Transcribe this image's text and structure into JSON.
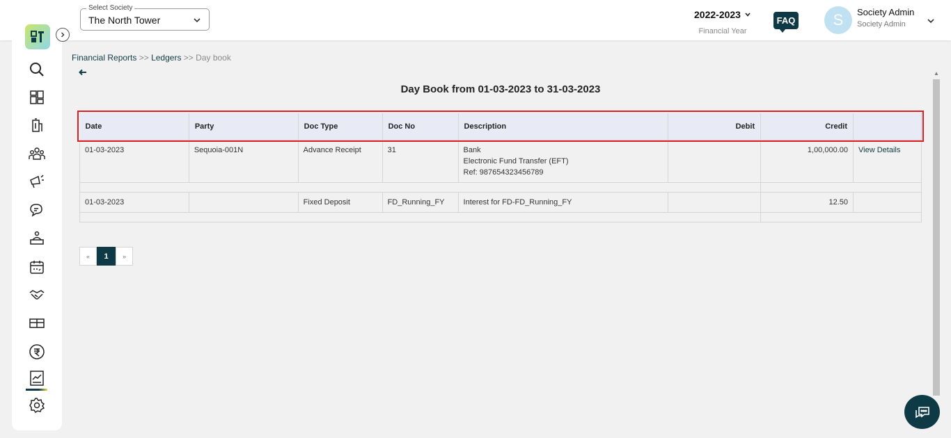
{
  "society_select": {
    "legend": "Select Society",
    "value": "The North Tower"
  },
  "financial_year": {
    "year": "2022-2023",
    "label": "Financial Year"
  },
  "faq_label": "FAQ",
  "user": {
    "avatar_letter": "S",
    "name": "Society Admin",
    "role": "Society Admin"
  },
  "breadcrumb": {
    "item1": "Financial Reports",
    "sep1": ">>",
    "item2": "Ledgers",
    "sep2": ">>",
    "current": "Day book"
  },
  "page_title": "Day Book from 01-03-2023 to 31-03-2023",
  "table": {
    "headers": {
      "date": "Date",
      "party": "Party",
      "doc_type": "Doc Type",
      "doc_no": "Doc No",
      "description": "Description",
      "debit": "Debit",
      "credit": "Credit"
    },
    "rows": [
      {
        "date": "01-03-2023",
        "party": "Sequoia-001N",
        "doc_type": "Advance Receipt",
        "doc_no": "31",
        "description_lines": [
          "Bank",
          "Electronic Fund Transfer (EFT)",
          "Ref: 987654323456789"
        ],
        "debit": "",
        "credit": "1,00,000.00",
        "action": "View Details"
      },
      {
        "date": "01-03-2023",
        "party": "",
        "doc_type": "Fixed Deposit",
        "doc_no": "FD_Running_FY",
        "description_lines": [
          "Interest for FD-FD_Running_FY"
        ],
        "debit": "",
        "credit": "12.50",
        "action": ""
      }
    ]
  },
  "pagination": {
    "prev": "«",
    "current": "1",
    "next": "»"
  },
  "colors": {
    "primary": "#0e3a45",
    "highlight_border": "#e01e26",
    "header_bg": "#e8ebf5"
  },
  "icons": [
    "search-icon",
    "dashboard-icon",
    "building-icon",
    "members-icon",
    "announcement-icon",
    "chat-icon",
    "service-icon",
    "calendar-icon",
    "handshake-icon",
    "box-icon",
    "rupee-icon",
    "reports-icon",
    "settings-icon"
  ]
}
